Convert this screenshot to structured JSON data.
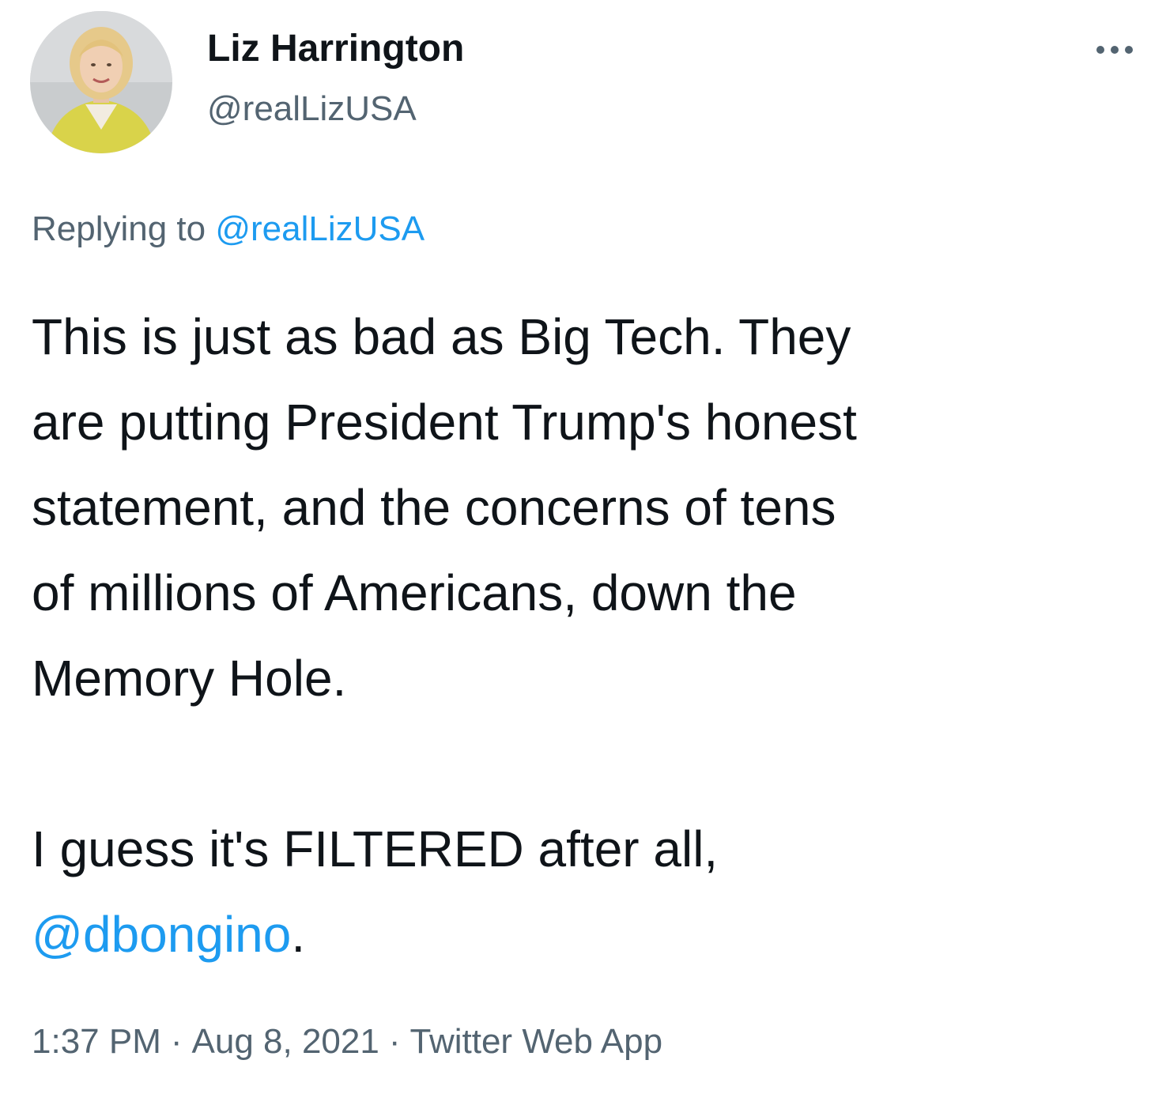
{
  "author": {
    "display_name": "Liz Harrington",
    "handle": "@realLizUSA",
    "avatar_icon": "profile-photo"
  },
  "more_icon": "more-horizontal-icon",
  "reply_context": {
    "prefix": "Replying to ",
    "mention": "@realLizUSA"
  },
  "body": {
    "lines": [
      "This is just as bad as Big Tech. They",
      "are putting President Trump's honest",
      "statement, and the concerns of tens",
      "of millions of Americans, down the",
      "Memory Hole."
    ],
    "second_paragraph": {
      "line1": "I guess it's FILTERED after all,",
      "mention": "@dbongino",
      "trailing": "."
    }
  },
  "meta": {
    "time": "1:37 PM",
    "separator": "·",
    "date": "Aug 8, 2021",
    "source": "Twitter Web App"
  },
  "colors": {
    "text": "#0f1419",
    "secondary": "#536471",
    "link": "#1d9bf0",
    "background": "#ffffff"
  }
}
